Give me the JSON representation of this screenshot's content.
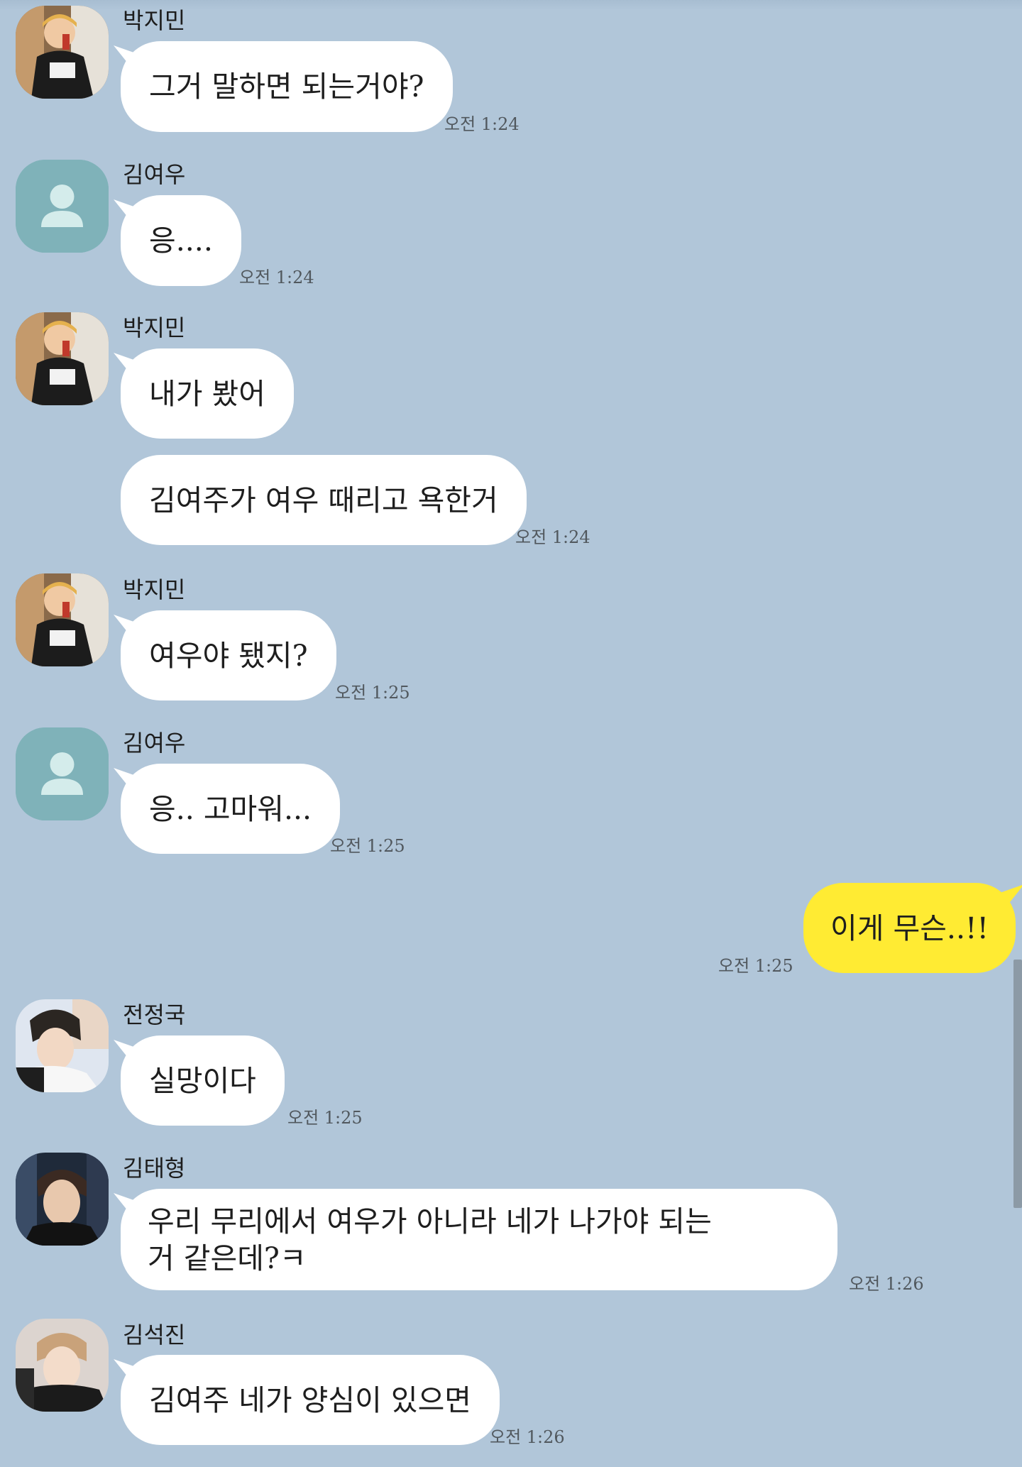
{
  "colors": {
    "background": "#b1c6d9",
    "bubble_other": "#ffffff",
    "bubble_mine": "#ffeb33",
    "default_avatar_bg": "#7fb2b9"
  },
  "messages": [
    {
      "sender": "박지민",
      "text": "그거 말하면 되는거야?",
      "time": "오전 1:24",
      "avatar_icon": "jimin-photo-avatar"
    },
    {
      "sender": "김여우",
      "text": "응....",
      "time": "오전 1:24",
      "avatar_icon": "default-person-icon"
    },
    {
      "sender": "박지민",
      "text": "내가 봤어",
      "time": "",
      "avatar_icon": "jimin-photo-avatar"
    },
    {
      "sender": "",
      "text": "김여주가 여우 때리고 욕한거",
      "time": "오전 1:24",
      "avatar_icon": ""
    },
    {
      "sender": "박지민",
      "text": "여우야 됐지?",
      "time": "오전 1:25",
      "avatar_icon": "jimin-photo-avatar"
    },
    {
      "sender": "김여우",
      "text": "응.. 고마워...",
      "time": "오전 1:25",
      "avatar_icon": "default-person-icon"
    },
    {
      "sender": "",
      "text": "이게 무슨..!!",
      "time": "오전 1:25",
      "avatar_icon": "",
      "mine": true
    },
    {
      "sender": "전정국",
      "text": "실망이다",
      "time": "오전 1:25",
      "avatar_icon": "jungkook-photo-avatar"
    },
    {
      "sender": "김태형",
      "text": "우리 무리에서 여우가 아니라 네가 나가야 되는거 같은데?ㅋ",
      "time": "오전 1:26",
      "avatar_icon": "taehyung-photo-avatar"
    },
    {
      "sender": "김석진",
      "text": "김여주 네가 양심이 있으면",
      "time": "오전 1:26",
      "avatar_icon": "seokjin-photo-avatar"
    }
  ]
}
